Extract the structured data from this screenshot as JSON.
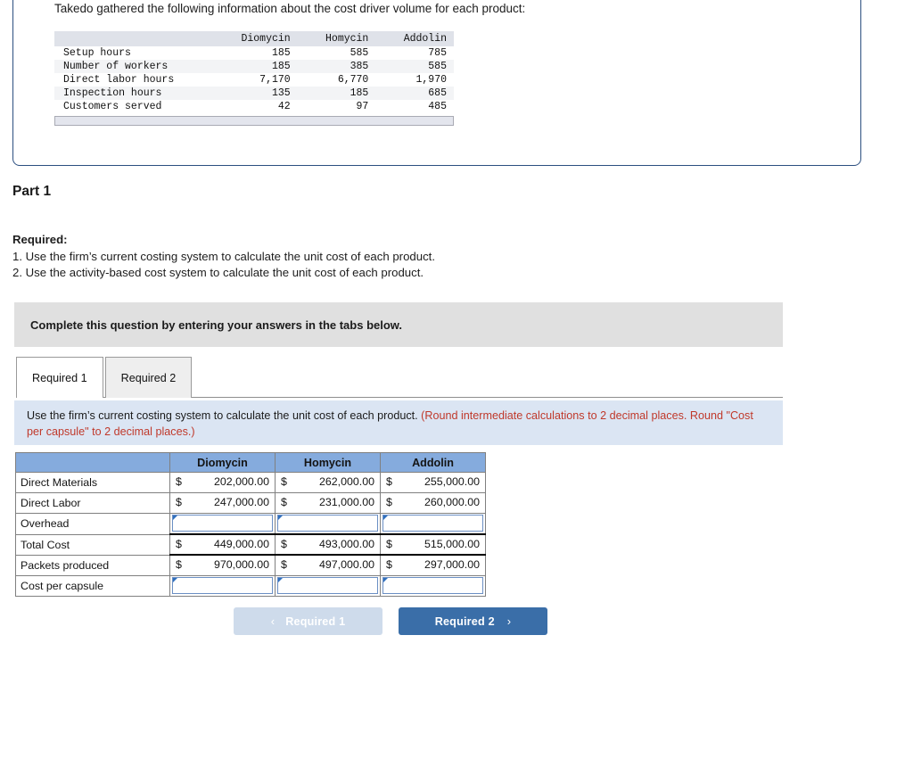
{
  "question_card": {
    "intro_text": "Takedo gathered the following information about the cost driver volume for each product:",
    "cost_driver_table": {
      "columns": [
        "",
        "Diomycin",
        "Homycin",
        "Addolin"
      ],
      "rows": [
        {
          "label": "Setup hours",
          "values": [
            "185",
            "585",
            "785"
          ]
        },
        {
          "label": "Number of workers",
          "values": [
            "185",
            "385",
            "585"
          ]
        },
        {
          "label": "Direct labor hours",
          "values": [
            "7,170",
            "6,770",
            "1,970"
          ]
        },
        {
          "label": "Inspection hours",
          "values": [
            "135",
            "185",
            "685"
          ]
        },
        {
          "label": "Customers served",
          "values": [
            "42",
            "97",
            "485"
          ]
        }
      ]
    }
  },
  "part": {
    "title": "Part 1",
    "required_heading": "Required:",
    "required_items": [
      "1. Use the firm’s current costing system to calculate the unit cost of each product.",
      "2. Use the activity-based cost system to calculate the unit cost of each product."
    ]
  },
  "banner": {
    "text": "Complete this question by entering your answers in the tabs below."
  },
  "tabs": [
    {
      "label": "Required 1",
      "active": true
    },
    {
      "label": "Required 2",
      "active": false
    }
  ],
  "instruction_panel": {
    "main": "Use the firm’s current costing system to calculate the unit cost of each product.",
    "note": "(Round intermediate calculations to 2 decimal places. Round \"Cost per capsule\" to 2 decimal places.)",
    "background_color": "#dbe5f3",
    "note_color": "#c0392b"
  },
  "answer_table": {
    "header_color": "#85ABDD",
    "columns": [
      "",
      "Diomycin",
      "Homycin",
      "Addolin"
    ],
    "rows": [
      {
        "label": "Direct Materials",
        "type": "value",
        "cells": [
          {
            "currency": "$",
            "amount": "202,000.00"
          },
          {
            "currency": "$",
            "amount": "262,000.00"
          },
          {
            "currency": "$",
            "amount": "255,000.00"
          }
        ]
      },
      {
        "label": "Direct Labor",
        "type": "value",
        "cells": [
          {
            "currency": "$",
            "amount": "247,000.00"
          },
          {
            "currency": "$",
            "amount": "231,000.00"
          },
          {
            "currency": "$",
            "amount": "260,000.00"
          }
        ]
      },
      {
        "label": "Overhead",
        "type": "input",
        "cells": [
          {
            "value": ""
          },
          {
            "value": ""
          },
          {
            "value": ""
          }
        ]
      },
      {
        "label": "Total Cost",
        "type": "total",
        "cells": [
          {
            "currency": "$",
            "amount": "449,000.00"
          },
          {
            "currency": "$",
            "amount": "493,000.00"
          },
          {
            "currency": "$",
            "amount": "515,000.00"
          }
        ]
      },
      {
        "label": "Packets produced",
        "type": "value",
        "cells": [
          {
            "currency": "$",
            "amount": "970,000.00"
          },
          {
            "currency": "$",
            "amount": "497,000.00"
          },
          {
            "currency": "$",
            "amount": "297,000.00"
          }
        ]
      },
      {
        "label": "Cost per capsule",
        "type": "input",
        "cells": [
          {
            "value": ""
          },
          {
            "value": ""
          },
          {
            "value": ""
          }
        ]
      }
    ]
  },
  "nav": {
    "prev_label": "Required 1",
    "prev_chevron": "‹",
    "next_label": "Required 2",
    "next_chevron": "›",
    "prev_color": "#cedbeb",
    "next_color": "#3a6ea8"
  }
}
